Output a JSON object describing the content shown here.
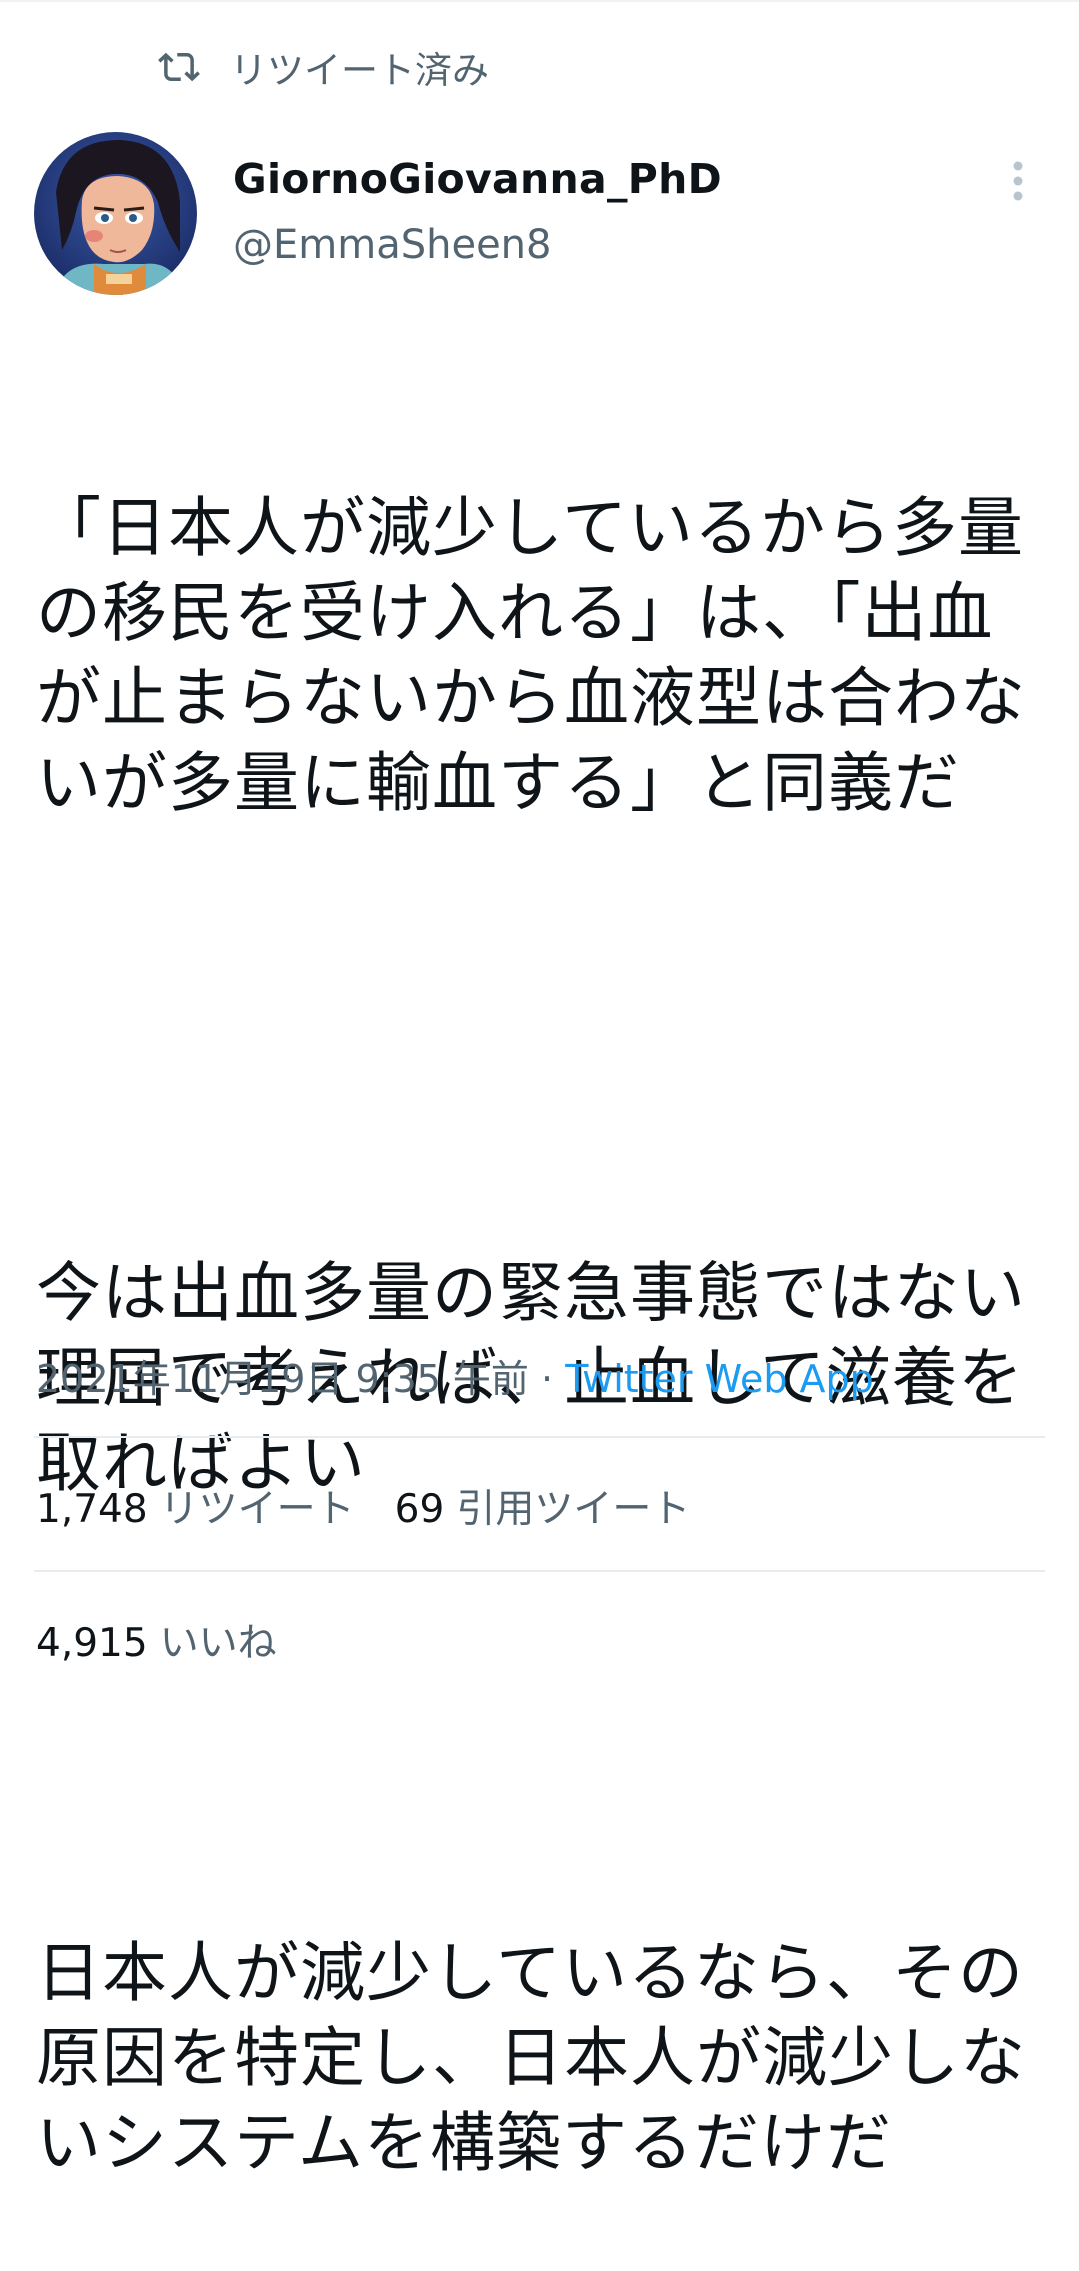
{
  "retweet_banner": {
    "icon": "retweet-icon",
    "label": "リツイート済み"
  },
  "author": {
    "display_name": "GiornoGiovanna_PhD",
    "handle": "@EmmaSheen8",
    "avatar": "avatar-image"
  },
  "tweet": {
    "paragraph_1": "「日本人が減少しているから多量の移民を受け入れる」は、「出血が止まらないから血液型は合わないが多量に輸血する」と同義だ",
    "paragraph_2": "今は出血多量の緊急事態ではない理屈で考えれば、止血して滋養を取ればよい",
    "paragraph_3": "日本人が減少しているなら、その原因を特定し、日本人が減少しないシステムを構築するだけだ"
  },
  "meta": {
    "timestamp": "2021年11月19日 9:35 午前",
    "separator": "·",
    "source": "Twitter Web App"
  },
  "stats": {
    "retweets_count": "1,748",
    "retweets_label": "リツイート",
    "quotes_count": "69",
    "quotes_label": "引用ツイート",
    "likes_count": "4,915",
    "likes_label": "いいね"
  },
  "colors": {
    "text": "#0f1419",
    "secondary": "#536471",
    "link": "#1d9bf0",
    "divider": "#e6ecf0"
  }
}
